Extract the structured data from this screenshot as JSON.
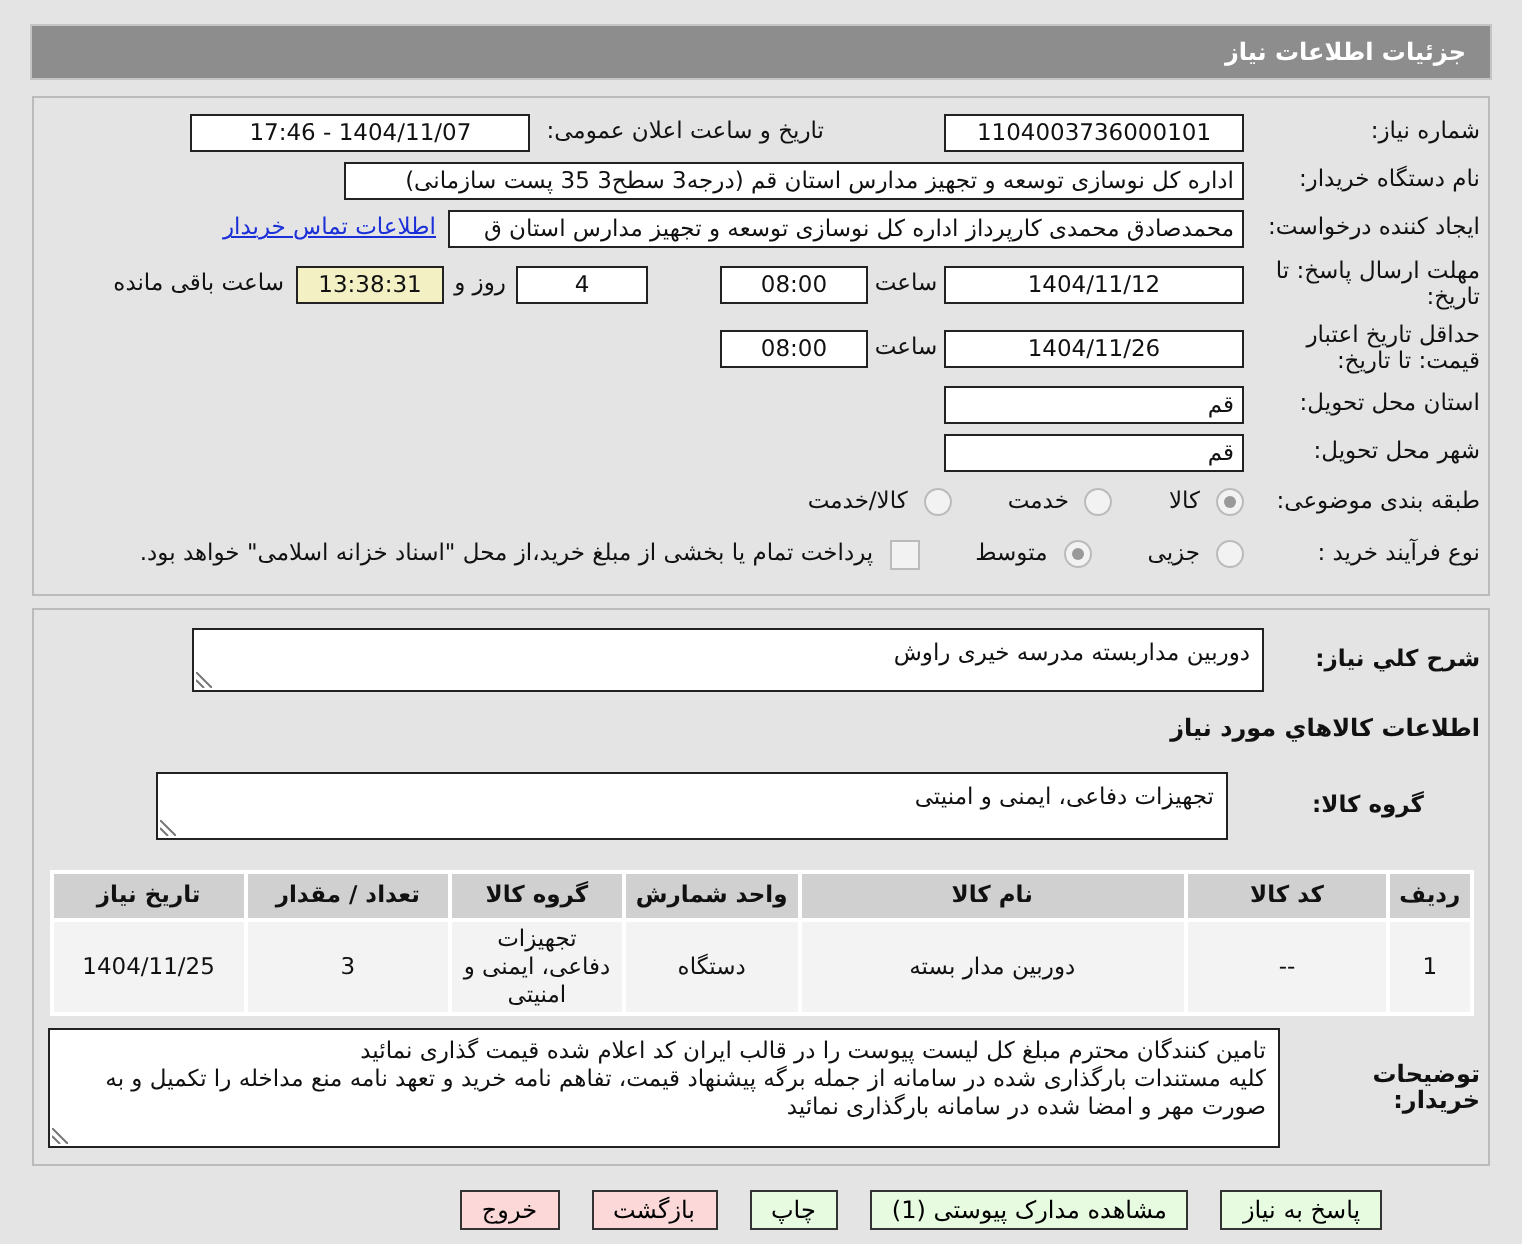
{
  "page_title": "جزئیات اطلاعات نیاز",
  "need_number": {
    "label": "شماره نیاز:",
    "value": "1104003736000101"
  },
  "announce": {
    "label": "تاریخ و ساعت اعلان عمومی:",
    "value": "1404/11/07 - 17:46"
  },
  "buyer": {
    "label": "نام دستگاه خریدار:",
    "value": "اداره کل نوسازی   توسعه و تجهیز مدارس استان قم (درجه3 سطح3  35 پست سازمانی)"
  },
  "requester": {
    "label": "ایجاد کننده درخواست:",
    "value": "محمدصادق محمدی کارپرداز  اداره کل نوسازی   توسعه و تجهیز مدارس استان ق",
    "link": "اطلاعات تماس خریدار"
  },
  "deadline": {
    "label": "مهلت ارسال پاسخ: تا تاریخ:",
    "date": "1404/11/12",
    "time_label": "ساعت",
    "time": "08:00",
    "days": "4",
    "days_label": "روز و",
    "remaining": "13:38:31",
    "remaining_label": "ساعت باقی مانده"
  },
  "validity": {
    "label": "حداقل تاریخ اعتبار قیمت: تا تاریخ:",
    "date": "1404/11/26",
    "time_label": "ساعت",
    "time": "08:00"
  },
  "province": {
    "label": "استان محل تحویل:",
    "value": "قم"
  },
  "city": {
    "label": "شهر محل تحویل:",
    "value": "قم"
  },
  "category": {
    "label": "طبقه بندی موضوعی:",
    "options": [
      {
        "kind": "radio",
        "label": "کالا",
        "selected": true
      },
      {
        "kind": "radio",
        "label": "خدمت",
        "selected": false
      },
      {
        "kind": "radio",
        "label": "کالا/خدمت",
        "selected": false
      }
    ]
  },
  "process": {
    "label": "نوع فرآیند خرید :",
    "options": [
      {
        "kind": "radio",
        "label": "جزیی",
        "selected": false
      },
      {
        "kind": "radio",
        "label": "متوسط",
        "selected": true
      },
      {
        "kind": "checkbox",
        "label": "پرداخت تمام یا بخشی از مبلغ خرید،از محل \"اسناد خزانه اسلامی\" خواهد بود.",
        "selected": false
      }
    ]
  },
  "description": {
    "label": "شرح کلي نیاز:",
    "value": "دوربین مداربسته مدرسه خیری راوش"
  },
  "goods_heading": "اطلاعات کالاهاي مورد نیاز",
  "goods_group": {
    "label": "گروه کالا:",
    "value": "تجهیزات دفاعی، ایمنی و امنیتی"
  },
  "table": {
    "columns": [
      "ردیف",
      "کد کالا",
      "نام کالا",
      "واحد شمارش",
      "گروه کالا",
      "تعداد / مقدار",
      "تاریخ نیاز"
    ],
    "rows": [
      [
        "1",
        "--",
        "دوربین مدار بسته",
        "دستگاه",
        "تجهیزات دفاعی، ایمنی و امنیتی",
        "3",
        "1404/11/25"
      ]
    ]
  },
  "buyer_notes": {
    "label": "توضیحات خریدار:",
    "lines": [
      "تامین کنندگان محترم مبلغ کل لیست پیوست را در قالب ایران کد اعلام شده قیمت گذاری نمائید",
      "کلیه مستندات بارگذاری شده در سامانه از جمله برگه پیشنهاد قیمت، تفاهم نامه خرید و تعهد نامه منع مداخله را تکمیل و به",
      "صورت مهر و امضا شده در سامانه بارگذاری نمائید"
    ]
  },
  "buttons": [
    {
      "label": "پاسخ به نیاز",
      "color": "#e6fbe0"
    },
    {
      "label": "مشاهده مدارک پیوستی (1)",
      "color": "#e6fbe0"
    },
    {
      "label": "چاپ",
      "color": "#e6fbe0"
    },
    {
      "label": "بازگشت",
      "color": "#fdd8d8"
    },
    {
      "label": "خروج",
      "color": "#fdd8d8"
    }
  ]
}
